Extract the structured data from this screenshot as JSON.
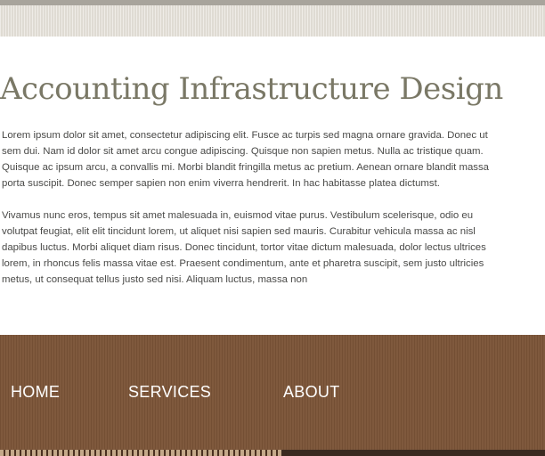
{
  "header": {
    "title": "Accounting Infrastructure Design"
  },
  "content": {
    "paragraphs": [
      "Lorem ipsum dolor sit amet, consectetur adipiscing elit. Fusce ac turpis sed magna ornare gravida. Donec ut sem dui. Nam id dolor sit amet arcu congue adipiscing. Quisque non sapien metus. Nulla ac tristique quam. Quisque ac ipsum arcu, a convallis mi. Morbi blandit fringilla metus ac pretium. Aenean ornare blandit massa porta suscipit. Donec semper sapien non enim viverra hendrerit. In hac habitasse platea dictumst.",
      "Vivamus nunc eros, tempus sit amet malesuada in, euismod vitae purus. Vestibulum scelerisque, odio eu volutpat feugiat, elit elit tincidunt lorem, ut aliquet nisi sapien sed mauris. Curabitur vehicula massa ac nisl dapibus luctus. Morbi aliquet diam risus. Donec tincidunt, tortor vitae dictum malesuada, dolor lectus ultrices lorem, in rhoncus felis massa vitae est. Praesent condimentum, ante et pharetra suscipit, sem justo ultricies metus, ut consequat tellus justo sed nisi. Aliquam luctus, massa non"
    ]
  },
  "footer": {
    "nav": {
      "home": "HOME",
      "services": "SERVICES",
      "about": "ABOUT"
    }
  },
  "colors": {
    "title": "#7a7866",
    "body_text": "#4a4a48",
    "footer_bg": "#7b5437",
    "header_band": "#e6e2da"
  }
}
